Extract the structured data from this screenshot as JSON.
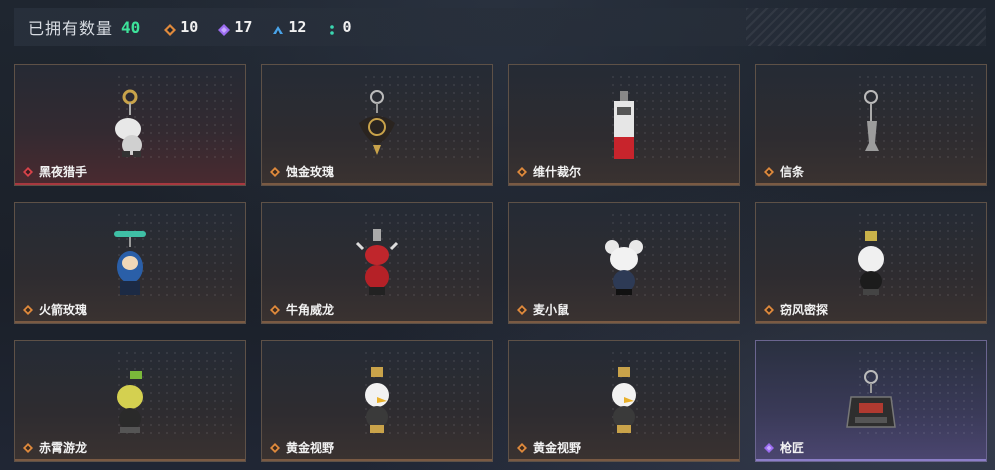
{
  "header": {
    "owned_label": "已拥有数量",
    "owned_count": "40",
    "stats": [
      {
        "icon": "orange-diamond-icon",
        "color": "#e08a3c",
        "value": "10"
      },
      {
        "icon": "purple-diamond-icon",
        "color": "#9b6cf0",
        "value": "17"
      },
      {
        "icon": "blue-triangle-icon",
        "color": "#4aa3e8",
        "value": "12"
      },
      {
        "icon": "teal-dots-icon",
        "color": "#3ad6b0",
        "value": "0"
      }
    ]
  },
  "items": [
    {
      "name": "黑夜猎手",
      "rarity": "red",
      "rarity_icon": "red-diamond-icon"
    },
    {
      "name": "蚀金玫瑰",
      "rarity": "orange",
      "rarity_icon": "orange-diamond-icon"
    },
    {
      "name": "维什裁尔",
      "rarity": "orange",
      "rarity_icon": "orange-diamond-icon"
    },
    {
      "name": "信条",
      "rarity": "orange",
      "rarity_icon": "orange-diamond-icon"
    },
    {
      "name": "火箭玫瑰",
      "rarity": "orange",
      "rarity_icon": "orange-diamond-icon"
    },
    {
      "name": "牛角威龙",
      "rarity": "orange",
      "rarity_icon": "orange-diamond-icon"
    },
    {
      "name": "麦小鼠",
      "rarity": "orange",
      "rarity_icon": "orange-diamond-icon"
    },
    {
      "name": "窃风密探",
      "rarity": "orange",
      "rarity_icon": "orange-diamond-icon"
    },
    {
      "name": "赤霄游龙",
      "rarity": "orange",
      "rarity_icon": "orange-diamond-icon"
    },
    {
      "name": "黄金视野",
      "rarity": "orange",
      "rarity_icon": "orange-diamond-icon"
    },
    {
      "name": "黄金视野",
      "rarity": "orange",
      "rarity_icon": "orange-diamond-icon"
    },
    {
      "name": "枪匠",
      "rarity": "purple",
      "rarity_icon": "purple-diamond-icon"
    }
  ],
  "colors": {
    "count_green": "#3de29a",
    "rarity_red": "#d9434a",
    "rarity_orange": "#e08a3c",
    "rarity_purple": "#9b6cf0"
  }
}
